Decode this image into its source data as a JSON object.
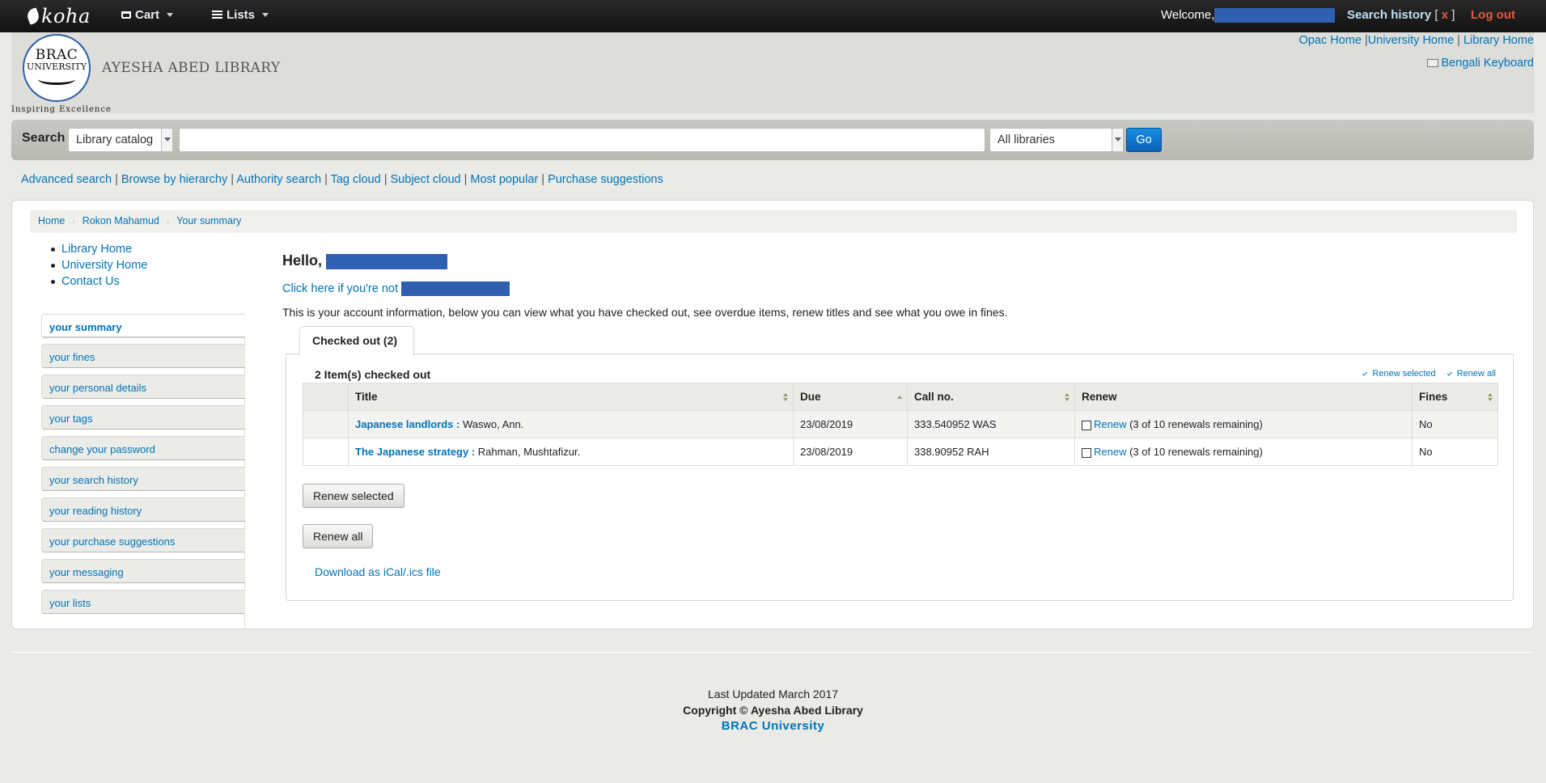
{
  "navbar": {
    "brand": "koha",
    "cart_label": "Cart",
    "lists_label": "Lists",
    "welcome_label": "Welcome,",
    "search_history_label": "Search history",
    "search_history_clear": "x",
    "logout_label": "Log out"
  },
  "header": {
    "logo_line1": "BRAC",
    "logo_line2": "UNIVERSITY",
    "tagline": "Inspiring Excellence",
    "library_name": "AYESHA ABED LIBRARY",
    "links": [
      "Opac Home",
      "University Home",
      "Library Home"
    ],
    "keyboard_link": "Bengali Keyboard"
  },
  "search": {
    "label": "Search",
    "scope": "Library catalog",
    "query": "",
    "branch": "All libraries",
    "go_label": "Go"
  },
  "subnav": [
    "Advanced search",
    "Browse by hierarchy",
    "Authority search",
    "Tag cloud",
    "Subject cloud",
    "Most popular",
    "Purchase suggestions"
  ],
  "breadcrumb": [
    "Home",
    "Rokon Mahamud",
    "Your summary"
  ],
  "side_links": [
    "Library Home",
    "University Home",
    "Contact Us"
  ],
  "user_menu": [
    "your summary",
    "your fines",
    "your personal details",
    "your tags",
    "change your password",
    "your search history",
    "your reading history",
    "your purchase suggestions",
    "your messaging",
    "your lists"
  ],
  "main": {
    "hello": "Hello,",
    "not_you": "Click here if you're not",
    "account_info": "This is your account information, below you can view what you have checked out, see overdue items, renew titles and see what you owe in fines.",
    "tab_label": "Checked out (2)",
    "items_checked_out": "2 Item(s) checked out",
    "renew_selected_link": "Renew selected",
    "renew_all_link": "Renew all",
    "columns": [
      "Title",
      "Due",
      "Call no.",
      "Renew",
      "Fines"
    ],
    "rows": [
      {
        "title": "Japanese landlords :",
        "author": "Waswo, Ann.",
        "due": "23/08/2019",
        "callno": "333.540952 WAS",
        "renew": "Renew",
        "renew_note": "(3 of 10 renewals remaining)",
        "fines": "No"
      },
      {
        "title": "The Japanese strategy :",
        "author": "Rahman, Mushtafizur.",
        "due": "23/08/2019",
        "callno": "338.90952 RAH",
        "renew": "Renew",
        "renew_note": "(3 of 10 renewals remaining)",
        "fines": "No"
      }
    ],
    "renew_selected_btn": "Renew selected",
    "renew_all_btn": "Renew all",
    "ical_link": "Download as iCal/.ics file"
  },
  "footer": {
    "updated": "Last Updated March 2017",
    "copyright": "Copyright © Ayesha Abed Library",
    "university": "BRAC University"
  }
}
